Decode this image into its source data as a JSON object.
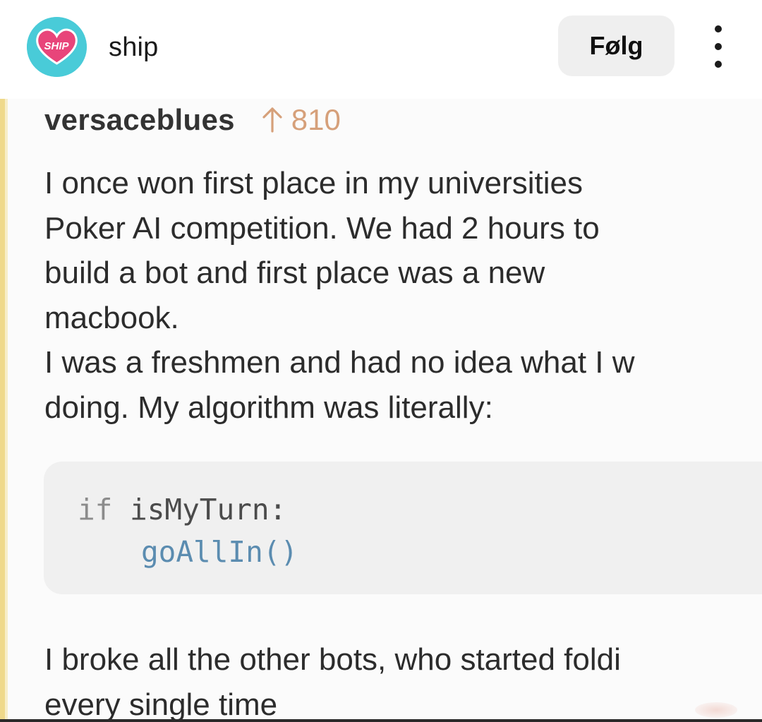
{
  "header": {
    "avatar_logo_text": "SHIP",
    "account_name": "ship",
    "follow_label": "Følg",
    "more_icon": "more-vertical-icon"
  },
  "post": {
    "comment_user": "versaceblues",
    "upvote_icon": "arrow-up-icon",
    "upvote_count": "810",
    "paragraph_1": [
      "I once won first place in my universities",
      "Poker AI competition. We had 2 hours to",
      "build a bot and first place was a new",
      "macbook."
    ],
    "paragraph_2": [
      "I was a freshmen and had no idea what I w",
      "doing. My algorithm was literally:"
    ],
    "code": {
      "keyword": "if",
      "condition": " isMyTurn:",
      "call": "goAllIn()"
    },
    "paragraph_3": [
      "I broke all the other bots, who started foldi",
      "every single time"
    ]
  },
  "colors": {
    "avatar_bg": "#49cbd8",
    "logo_heart": "#e8457a",
    "follow_bg": "#efefef",
    "upvote": "#d6a07a",
    "code_bg": "#f0f0f0",
    "code_call": "#5b8cb0",
    "left_rule": "#efd98a"
  }
}
